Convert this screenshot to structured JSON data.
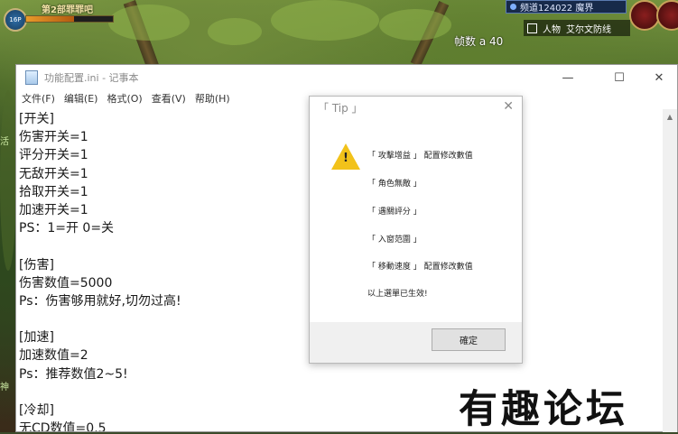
{
  "game": {
    "player_name": "第2部罪罪吧",
    "level_badge": "16P",
    "hp_fraction": 0.55,
    "channel": "频道124022 魔界",
    "map_menu": "人物",
    "map_location": "艾尔文防线",
    "floating_text": "帧数 a 40",
    "side_text_1": "活",
    "side_text_2": "神"
  },
  "notepad": {
    "title": "功能配置.ini - 记事本",
    "minimize_symbol": "—",
    "maximize_symbol": "☐",
    "close_symbol": "✕",
    "menu": [
      "文件(F)",
      "编辑(E)",
      "格式(O)",
      "查看(V)",
      "帮助(H)"
    ],
    "lines": [
      "[开关]",
      "伤害开关=1",
      "评分开关=1",
      "无敌开关=1",
      "拾取开关=1",
      "加速开关=1",
      "PS：1=开 0=关",
      "",
      "[伤害]",
      "伤害数值=5000",
      "Ps：伤害够用就好,切勿过高!",
      "",
      "[加速]",
      "加速数值=2",
      "Ps：推荐数值2~5!",
      "",
      "[冷却]",
      "无CD数值=0.5"
    ]
  },
  "tip": {
    "title": "「 Tip 」",
    "close_symbol": "✕",
    "lines": [
      "「 攻擊增益 」 配置修改數值",
      "「 角色無敵 」",
      "「 遇關評分 」",
      "「 入窗范圍 」",
      "「 移動速度 」 配置修改數值",
      "以上選單已生效!"
    ],
    "ok_label": "確定"
  },
  "watermark": "有趣论坛"
}
